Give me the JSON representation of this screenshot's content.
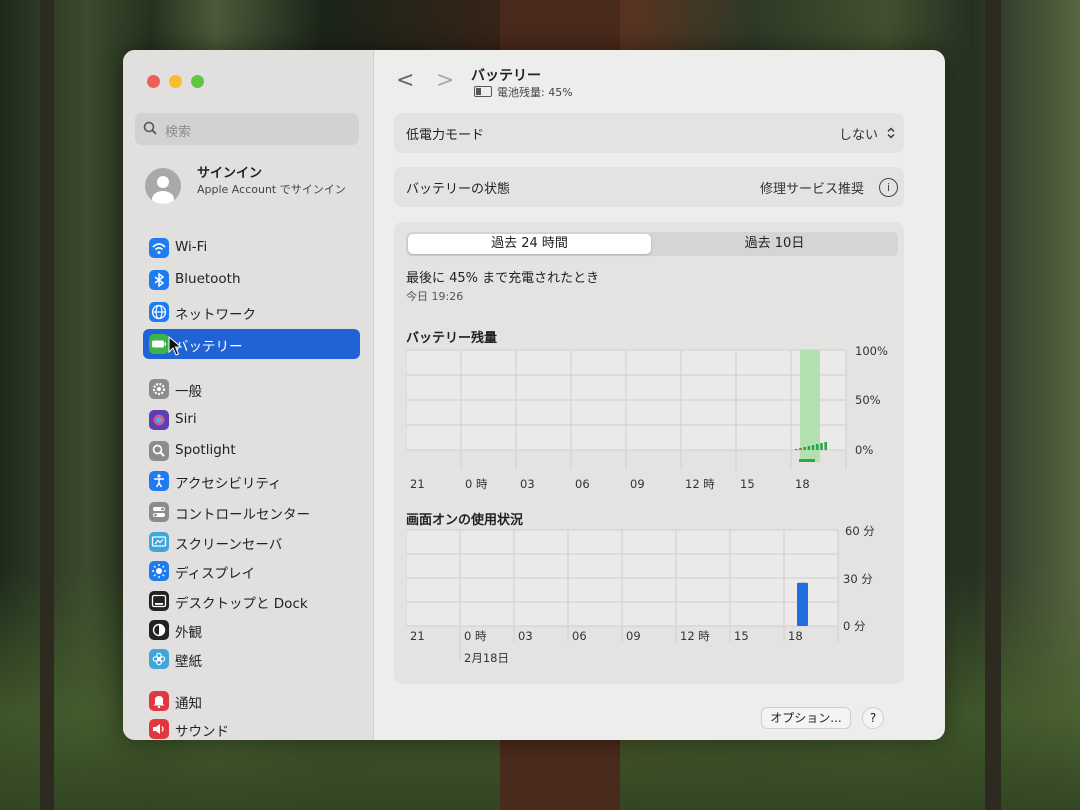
{
  "window": {
    "traffic_colors": [
      "#ee5f57",
      "#f5bd2f",
      "#5fc73f"
    ]
  },
  "sidebar": {
    "search_placeholder": "検索",
    "account": {
      "title": "サインイン",
      "subtitle": "Apple Account でサインイン"
    },
    "items": [
      {
        "label": "Wi-Fi",
        "icon": "wifi-icon",
        "color": "#1f7cf0"
      },
      {
        "label": "Bluetooth",
        "icon": "bluetooth-icon",
        "color": "#1f7cf0"
      },
      {
        "label": "ネットワーク",
        "icon": "globe-icon",
        "color": "#1f7cf0"
      },
      {
        "label": "バッテリー",
        "icon": "battery-icon",
        "color": "#3db34a",
        "selected": true
      },
      {
        "label": "一般",
        "icon": "gear-icon",
        "color": "#8c8c8c"
      },
      {
        "label": "Siri",
        "icon": "siri-icon",
        "color": "#5b3fb5"
      },
      {
        "label": "Spotlight",
        "icon": "magnifier-icon",
        "color": "#8c8c8c"
      },
      {
        "label": "アクセシビリティ",
        "icon": "accessibility-icon",
        "color": "#1f7cf0"
      },
      {
        "label": "コントロールセンター",
        "icon": "toggles-icon",
        "color": "#8c8c8c"
      },
      {
        "label": "スクリーンセーバ",
        "icon": "screensaver-icon",
        "color": "#3ea6d8"
      },
      {
        "label": "ディスプレイ",
        "icon": "sun-icon",
        "color": "#1f7cf0"
      },
      {
        "label": "デスクトップと Dock",
        "icon": "dock-icon",
        "color": "#222222"
      },
      {
        "label": "外観",
        "icon": "appearance-icon",
        "color": "#222222"
      },
      {
        "label": "壁紙",
        "icon": "flower-icon",
        "color": "#3ea6d8"
      },
      {
        "label": "通知",
        "icon": "bell-icon",
        "color": "#e0383e"
      },
      {
        "label": "サウンド",
        "icon": "speaker-icon",
        "color": "#e0383e"
      }
    ]
  },
  "header": {
    "back": "<",
    "forward": ">",
    "title": "バッテリー",
    "subtitle": "電池残量: 45%"
  },
  "low_power": {
    "label": "低電力モード",
    "value": "しない"
  },
  "health": {
    "label": "バッテリーの状態",
    "value": "修理サービス推奨",
    "info": "i"
  },
  "tabs": {
    "active": "過去 24 時間",
    "inactive": "過去 10日"
  },
  "last_charged": {
    "text": "最後に 45% まで充電されたとき",
    "time": "今日 19:26"
  },
  "chart_data": [
    {
      "type": "bar",
      "title": "バッテリー残量",
      "x_ticks": [
        "21",
        "0 時",
        "03",
        "06",
        "09",
        "12 時",
        "15",
        "18"
      ],
      "y_ticks": [
        "100%",
        "50%",
        "0%"
      ],
      "ylim": [
        0,
        100
      ],
      "series": [
        {
          "values": [
            1,
            2,
            3,
            4,
            5,
            6,
            7,
            8
          ]
        }
      ]
    },
    {
      "type": "bar",
      "title": "画面オンの使用状況",
      "x_ticks": [
        "21",
        "0 時",
        "03",
        "06",
        "09",
        "12 時",
        "15",
        "18"
      ],
      "x_sublabel": "2月18日",
      "y_ticks": [
        "60 分",
        "30 分",
        "0 分"
      ],
      "ylim": [
        0,
        60
      ],
      "series": [
        {
          "values": [
            27
          ]
        }
      ]
    }
  ],
  "footer": {
    "options": "オプション...",
    "help": "?"
  }
}
